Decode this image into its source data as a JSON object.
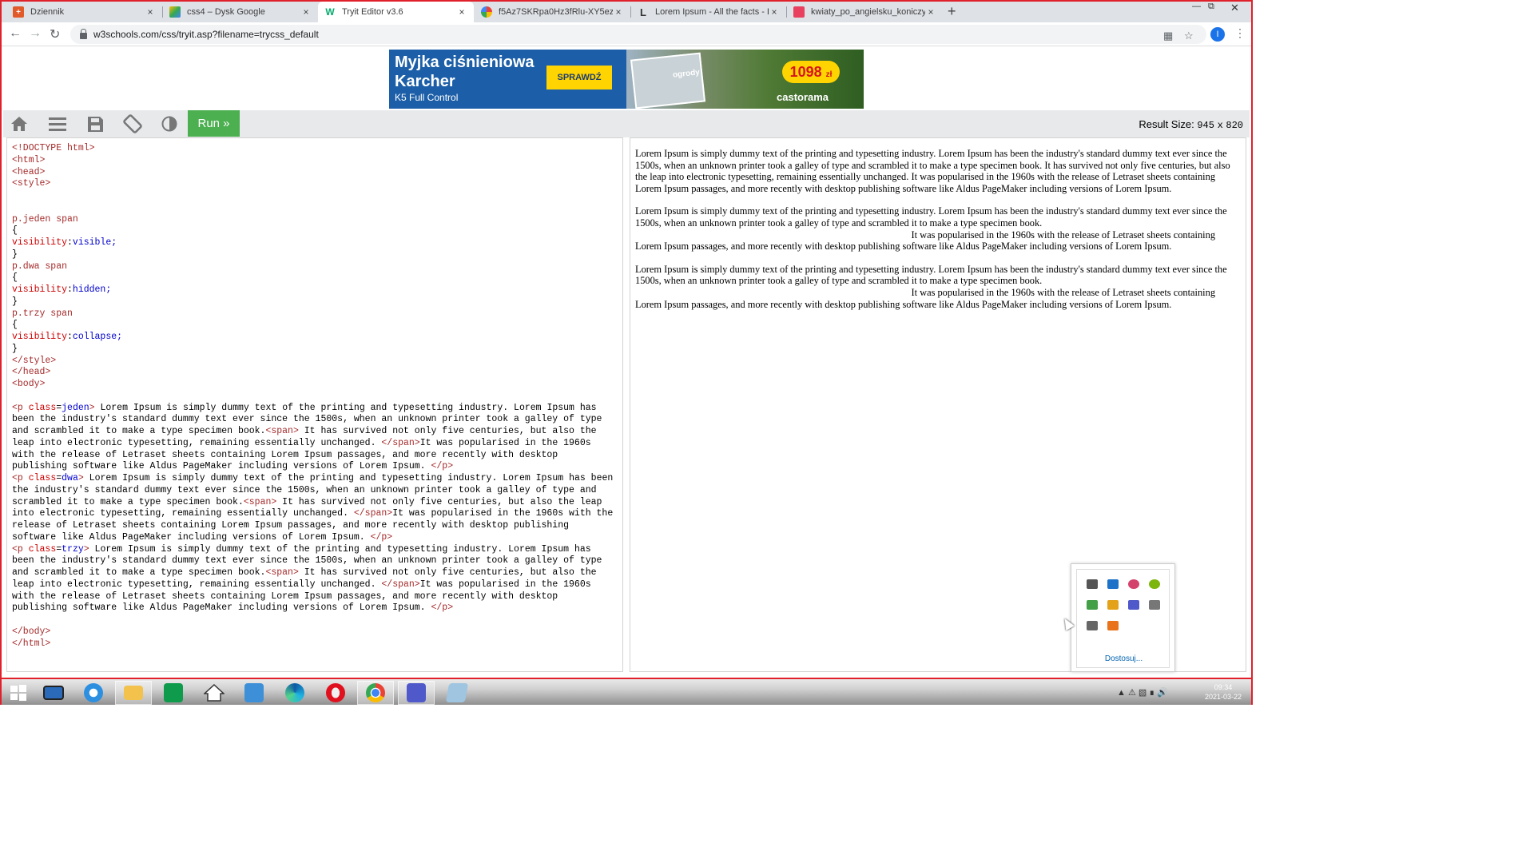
{
  "browser": {
    "tabs": [
      {
        "title": "Dziennik",
        "active": false
      },
      {
        "title": "css4 – Dysk Google",
        "active": false
      },
      {
        "title": "Tryit Editor v3.6",
        "active": true
      },
      {
        "title": "f5Az7SKRpa0Hz3fRlu-XY5ezMm",
        "active": false
      },
      {
        "title": "Lorem Ipsum - All the facts - Lips",
        "active": false
      },
      {
        "title": "kwiaty_po_angielsku_koniczyna-",
        "active": false
      }
    ],
    "close_symbol": "×",
    "new_tab_symbol": "+",
    "url": "w3schools.com/css/tryit.asp?filename=trycss_default",
    "profile_initial": "I"
  },
  "ad": {
    "title": "Myjka ciśnieniowa Karcher",
    "subtitle": "K5 Full Control",
    "button": "SPRAWDŹ",
    "price": "1098",
    "currency": "zł",
    "brand": "castorama",
    "photo_label": "ogrody"
  },
  "tryit": {
    "run_label": "Run »",
    "result_size_label": "Result Size:",
    "result_width": "945",
    "result_x": "x",
    "result_height": "820"
  },
  "code": {
    "doctype": "<!DOCTYPE html>",
    "html_open": "<html>",
    "head_open": "<head>",
    "style_open": "<style>",
    "rule1_sel": "p.jeden span",
    "rule1_prop": "visibility",
    "rule1_val": "visible;",
    "rule2_sel": "p.dwa span",
    "rule2_prop": "visibility",
    "rule2_val": "hidden;",
    "rule3_sel": "p.trzy span",
    "rule3_prop": "visibility",
    "rule3_val": "collapse;",
    "brace_open": "{",
    "brace_close": "}",
    "style_close": "</style>",
    "head_close": "</head>",
    "body_open": "<body>",
    "p_open_prefix": "<p ",
    "p_attr": "class",
    "p1_class": "jeden",
    "p2_class": "dwa",
    "p3_class": "trzy",
    "p_open_suffix": ">",
    "text_a": " Lorem Ipsum is simply dummy text of the printing and typesetting industry. Lorem Ipsum has been the industry's standard dummy text ever since the 1500s, when an unknown printer took a galley of type and scrambled it to make a type specimen book.",
    "span_open": "<span>",
    "text_b": " It has survived not only five centuries, but also the leap into electronic typesetting, remaining essentially unchanged. ",
    "span_close": "</span>",
    "text_c": "It was popularised in the 1960s with the release of Letraset sheets containing Lorem Ipsum passages, and more recently with desktop publishing software like Aldus PageMaker including versions of Lorem Ipsum. ",
    "p_close": "</p>",
    "body_close": "</body>",
    "html_close": "</html>"
  },
  "result": {
    "part1": "Lorem Ipsum is simply dummy text of the printing and typesetting industry. Lorem Ipsum has been the industry's standard dummy text ever since the 1500s, when an unknown printer took a galley of type and scrambled it to make a type specimen book.",
    "part2": " It has survived not only five centuries, but also the leap into electronic typesetting, remaining essentially unchanged. ",
    "part3": "It was popularised in the 1960s with the release of Letraset sheets containing Lorem Ipsum passages, and more recently with desktop publishing software like Aldus PageMaker including versions of Lorem Ipsum."
  },
  "tray": {
    "customize_label": "Dostosuj..."
  },
  "taskbar": {
    "time": "09:34",
    "date": "2021-03-22"
  },
  "colors": {
    "run_green": "#4caf50",
    "accent_red": "#e0202a",
    "code_tag": "#a52a2a",
    "code_value": "#0000cd"
  }
}
